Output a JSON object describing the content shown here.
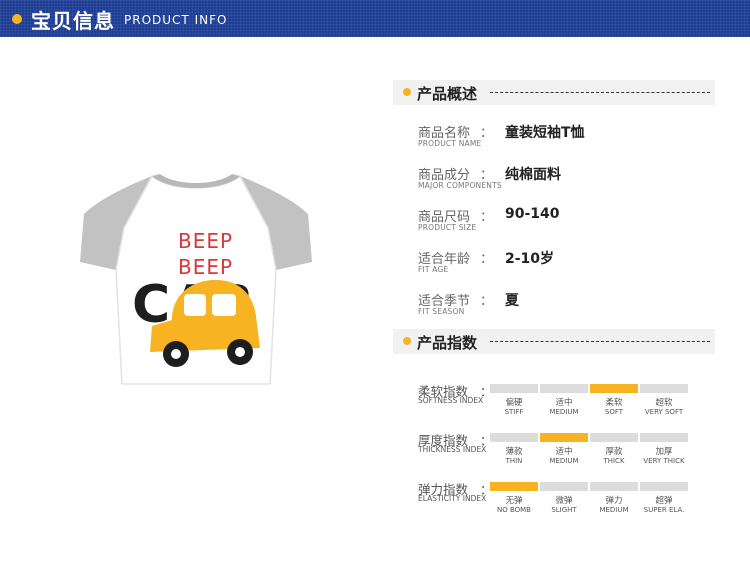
{
  "header": {
    "title": "宝贝信息",
    "subtitle": "PRODUCT INFO"
  },
  "product_image": {
    "shirt_print_line1": "BEEP",
    "shirt_print_line2": "BEEP",
    "shirt_print_word": "CAR"
  },
  "overview": {
    "title": "产品概述",
    "rows": [
      {
        "label": "商品名称",
        "label_en": "PRODUCT NAME",
        "value": "童装短袖T恤"
      },
      {
        "label": "商品成分",
        "label_en": "MAJOR COMPONENTS",
        "value": "纯棉面料"
      },
      {
        "label": "商品尺码",
        "label_en": "PRODUCT SIZE",
        "value": "90-140"
      },
      {
        "label": "适合年龄",
        "label_en": "FIT AGE",
        "value": "2-10岁"
      },
      {
        "label": "适合季节",
        "label_en": "FIT SEASON",
        "value": "夏"
      }
    ]
  },
  "indices": {
    "title": "产品指数",
    "rows": [
      {
        "label": "柔软指数",
        "label_en": "SOFTNESS INDEX",
        "selected_index": 2,
        "options": [
          {
            "cn": "偏硬",
            "en": "STIFF"
          },
          {
            "cn": "适中",
            "en": "MEDIUM"
          },
          {
            "cn": "柔软",
            "en": "SOFT"
          },
          {
            "cn": "超软",
            "en": "VERY SOFT"
          }
        ]
      },
      {
        "label": "厚度指数",
        "label_en": "THICKNESS INDEX",
        "selected_index": 1,
        "options": [
          {
            "cn": "薄款",
            "en": "THIN"
          },
          {
            "cn": "适中",
            "en": "MEDIUM"
          },
          {
            "cn": "厚款",
            "en": "THICK"
          },
          {
            "cn": "加厚",
            "en": "VERY THICK"
          }
        ]
      },
      {
        "label": "弹力指数",
        "label_en": "ELASTICITY INDEX",
        "selected_index": 0,
        "options": [
          {
            "cn": "无弹",
            "en": "NO BOMB"
          },
          {
            "cn": "微弹",
            "en": "SLIGHT"
          },
          {
            "cn": "弹力",
            "en": "MEDIUM"
          },
          {
            "cn": "超弹",
            "en": "SUPER ELA."
          }
        ]
      }
    ]
  },
  "colors": {
    "header_bg": "#1d3c93",
    "accent": "#f7b322",
    "inactive_bar": "#dcdcdc"
  }
}
